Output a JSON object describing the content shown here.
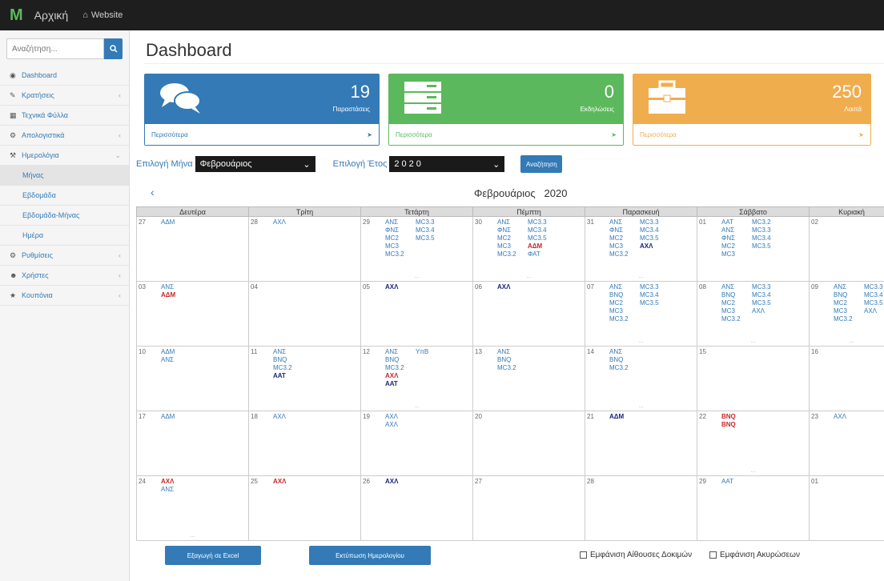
{
  "topbar": {
    "brand": "M",
    "home": "Αρχική",
    "website": "Website"
  },
  "sidebar": {
    "search_placeholder": "Αναζήτηση...",
    "items": [
      {
        "label": "Dashboard"
      },
      {
        "label": "Κρατήσεις"
      },
      {
        "label": "Τεχνικά Φύλλα"
      },
      {
        "label": "Απολογιστικά"
      },
      {
        "label": "Ημερολόγια"
      },
      {
        "label": "Μήνας"
      },
      {
        "label": "Εβδομάδα"
      },
      {
        "label": "Εβδομάδα-Μήνας"
      },
      {
        "label": "Ημέρα"
      },
      {
        "label": "Ρυθμίσεις"
      },
      {
        "label": "Χρήστες"
      },
      {
        "label": "Κουπόνια"
      }
    ]
  },
  "page": {
    "title": "Dashboard"
  },
  "cards": [
    {
      "number": "19",
      "label": "Παραστάσεις",
      "more": "Περισσότερα",
      "color": "#337ab7"
    },
    {
      "number": "0",
      "label": "Εκδηλώσεις",
      "more": "Περισσότερα",
      "color": "#5cb85c"
    },
    {
      "number": "250",
      "label": "Λοιπά",
      "more": "Περισσότερα",
      "color": "#f0ad4e"
    }
  ],
  "filters": {
    "month_label": "Επιλογή Μήνα",
    "month_value": "Φεβρουάριος",
    "year_label": "Επιλογή Έτος",
    "year_value": "2020",
    "search_button": "Αναζήτηση"
  },
  "calendar": {
    "prev": "‹",
    "month": "Φεβρουάριος",
    "year": "2020",
    "days": [
      "Δευτέρα",
      "Τρίτη",
      "Τετάρτη",
      "Πέμπτη",
      "Παρασκευή",
      "Σάββατο",
      "Κυριακή"
    ],
    "weeks": [
      [
        {
          "d": "27",
          "ev": [
            [
              "ΑΔΜ",
              ""
            ]
          ]
        },
        {
          "d": "28",
          "ev": [
            [
              "ΑΧΛ",
              ""
            ]
          ]
        },
        {
          "d": "29",
          "ev": [
            [
              "ΑΝΣ",
              ""
            ],
            [
              "MC3.3",
              ""
            ],
            [
              "ΦΝΣ",
              ""
            ],
            [
              "MC3.4",
              ""
            ],
            [
              "MC2",
              ""
            ],
            [
              "MC3.5",
              ""
            ],
            [
              "MC3",
              ""
            ],
            [
              "",
              ""
            ],
            [
              "MC3.2",
              ""
            ]
          ],
          "more": "..."
        },
        {
          "d": "30",
          "ev": [
            [
              "ΑΝΣ",
              ""
            ],
            [
              "MC3.3",
              ""
            ],
            [
              "ΦΝΣ",
              ""
            ],
            [
              "MC3.4",
              ""
            ],
            [
              "MC2",
              ""
            ],
            [
              "MC3.5",
              ""
            ],
            [
              "MC3",
              ""
            ],
            [
              "ΑΔΜ",
              "r"
            ],
            [
              "MC3.2",
              ""
            ],
            [
              "ΦΑΤ",
              ""
            ]
          ],
          "more": "..."
        },
        {
          "d": "31",
          "ev": [
            [
              "ΑΝΣ",
              ""
            ],
            [
              "MC3.3",
              ""
            ],
            [
              "ΦΝΣ",
              ""
            ],
            [
              "MC3.4",
              ""
            ],
            [
              "MC2",
              ""
            ],
            [
              "MC3.5",
              ""
            ],
            [
              "MC3",
              ""
            ],
            [
              "ΑΧΛ",
              "b"
            ],
            [
              "MC3.2",
              ""
            ]
          ],
          "more": "..."
        },
        {
          "d": "01",
          "ev": [
            [
              "ΑΑΤ",
              ""
            ],
            [
              "MC3.2",
              ""
            ],
            [
              "ΑΝΣ",
              ""
            ],
            [
              "MC3.3",
              ""
            ],
            [
              "ΦΝΣ",
              ""
            ],
            [
              "MC3.4",
              ""
            ],
            [
              "MC2",
              ""
            ],
            [
              "MC3.5",
              ""
            ],
            [
              "MC3",
              ""
            ]
          ]
        },
        {
          "d": "02",
          "ev": []
        }
      ],
      [
        {
          "d": "03",
          "ev": [
            [
              "ΑΝΣ",
              ""
            ],
            [
              "",
              ""
            ],
            [
              "ΑΔΜ",
              "r"
            ]
          ]
        },
        {
          "d": "04",
          "ev": []
        },
        {
          "d": "05",
          "ev": [
            [
              "ΑΧΛ",
              "b"
            ]
          ]
        },
        {
          "d": "06",
          "ev": [
            [
              "ΑΧΛ",
              "b"
            ]
          ]
        },
        {
          "d": "07",
          "ev": [
            [
              "ΑΝΣ",
              ""
            ],
            [
              "MC3.3",
              ""
            ],
            [
              "BNQ",
              ""
            ],
            [
              "MC3.4",
              ""
            ],
            [
              "MC2",
              ""
            ],
            [
              "MC3.5",
              ""
            ],
            [
              "MC3",
              ""
            ],
            [
              "",
              ""
            ],
            [
              "MC3.2",
              ""
            ]
          ],
          "more": "..."
        },
        {
          "d": "08",
          "ev": [
            [
              "ΑΝΣ",
              ""
            ],
            [
              "MC3.3",
              ""
            ],
            [
              "BNQ",
              ""
            ],
            [
              "MC3.4",
              ""
            ],
            [
              "MC2",
              ""
            ],
            [
              "MC3.5",
              ""
            ],
            [
              "MC3",
              ""
            ],
            [
              "ΑΧΛ",
              ""
            ],
            [
              "MC3.2",
              ""
            ]
          ],
          "more": "..."
        },
        {
          "d": "09",
          "ev": [
            [
              "ΑΝΣ",
              ""
            ],
            [
              "MC3.3",
              ""
            ],
            [
              "BNQ",
              ""
            ],
            [
              "MC3.4",
              ""
            ],
            [
              "MC2",
              ""
            ],
            [
              "MC3.5",
              ""
            ],
            [
              "MC3",
              ""
            ],
            [
              "ΑΧΛ",
              ""
            ],
            [
              "MC3.2",
              ""
            ]
          ],
          "more": "..."
        }
      ],
      [
        {
          "d": "10",
          "ev": [
            [
              "ΑΔΜ",
              ""
            ],
            [
              "",
              ""
            ],
            [
              "ΑΝΣ",
              ""
            ]
          ]
        },
        {
          "d": "11",
          "ev": [
            [
              "ΑΝΣ",
              ""
            ],
            [
              "",
              ""
            ],
            [
              "BNQ",
              ""
            ],
            [
              "",
              ""
            ],
            [
              "MC3.2",
              ""
            ],
            [
              "",
              ""
            ],
            [
              "ΑΑΤ",
              "b"
            ]
          ]
        },
        {
          "d": "12",
          "ev": [
            [
              "ΑΝΣ",
              ""
            ],
            [
              "ΥπΒ",
              ""
            ],
            [
              "BNQ",
              ""
            ],
            [
              "",
              ""
            ],
            [
              "MC3.2",
              ""
            ],
            [
              "",
              ""
            ],
            [
              "ΑΧΛ",
              "r"
            ],
            [
              "",
              ""
            ],
            [
              "ΑΑΤ",
              "b"
            ]
          ],
          "more": "..."
        },
        {
          "d": "13",
          "ev": [
            [
              "ΑΝΣ",
              ""
            ],
            [
              "",
              ""
            ],
            [
              "BNQ",
              ""
            ],
            [
              "",
              ""
            ],
            [
              "MC3.2",
              ""
            ]
          ]
        },
        {
          "d": "14",
          "ev": [
            [
              "ΑΝΣ",
              ""
            ],
            [
              "",
              ""
            ],
            [
              "BNQ",
              ""
            ],
            [
              "",
              ""
            ],
            [
              "MC3.2",
              ""
            ]
          ],
          "more": "..."
        },
        {
          "d": "15",
          "ev": []
        },
        {
          "d": "16",
          "ev": []
        }
      ],
      [
        {
          "d": "17",
          "ev": [
            [
              "ΑΔΜ",
              ""
            ]
          ]
        },
        {
          "d": "18",
          "ev": [
            [
              "ΑΧΛ",
              ""
            ]
          ]
        },
        {
          "d": "19",
          "ev": [
            [
              "ΑΧΛ",
              ""
            ],
            [
              "",
              ""
            ],
            [
              "ΑΧΛ",
              ""
            ]
          ]
        },
        {
          "d": "20",
          "ev": []
        },
        {
          "d": "21",
          "ev": [
            [
              "ΑΔΜ",
              "b"
            ]
          ]
        },
        {
          "d": "22",
          "ev": [
            [
              "BNQ",
              "r"
            ],
            [
              "",
              ""
            ],
            [
              "BNQ",
              "r"
            ]
          ],
          "more": "..."
        },
        {
          "d": "23",
          "ev": [
            [
              "ΑΧΛ",
              ""
            ]
          ]
        }
      ],
      [
        {
          "d": "24",
          "ev": [
            [
              "ΑΧΛ",
              "r"
            ],
            [
              "",
              ""
            ],
            [
              "ΑΝΣ",
              ""
            ]
          ],
          "more": "..."
        },
        {
          "d": "25",
          "ev": [
            [
              "ΑΧΛ",
              "r"
            ]
          ]
        },
        {
          "d": "26",
          "ev": [
            [
              "ΑΧΛ",
              "b"
            ]
          ]
        },
        {
          "d": "27",
          "ev": []
        },
        {
          "d": "28",
          "ev": []
        },
        {
          "d": "29",
          "ev": [
            [
              "ΑΑΤ",
              ""
            ]
          ]
        },
        {
          "d": "01",
          "ev": []
        }
      ]
    ]
  },
  "bottom": {
    "export_button": "Εξαγωγή σε Excel",
    "print_button": "Εκτύπωση Ημερολογίου",
    "show_rehearsal": "Εμφάνιση Αίθουσες Δοκιμών",
    "show_cancel": "Εμφάνιση Ακυρώσεων"
  }
}
